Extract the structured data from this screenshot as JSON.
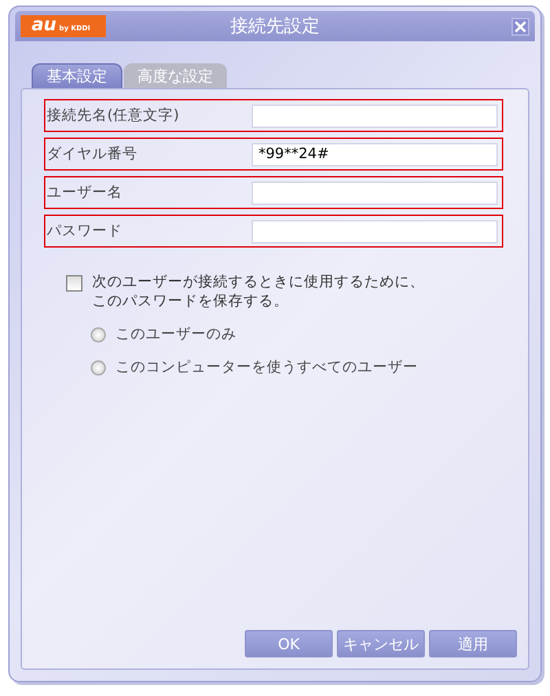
{
  "window": {
    "title": "接続先設定",
    "logo": "au",
    "logo_sub": "by KDDI"
  },
  "tabs": [
    {
      "label": "基本設定",
      "selected": true
    },
    {
      "label": "高度な設定",
      "selected": false
    }
  ],
  "fields": [
    {
      "label": "接続先名(任意文字)"
    },
    {
      "label": "ダイヤル番号",
      "value": "*99**24#"
    },
    {
      "label": "ユーザー名"
    },
    {
      "label": "パスワード"
    }
  ],
  "save_password": {
    "label": "次のユーザーが接続するときに使用するために、このパスワードを保存する。",
    "checked": false
  },
  "save_scope": [
    {
      "label": "このユーザーのみ",
      "selected": false
    },
    {
      "label": "このコンピューターを使うすべてのユーザー",
      "selected": false
    }
  ],
  "buttons": [
    "OK",
    "キャンセル",
    "適用"
  ]
}
